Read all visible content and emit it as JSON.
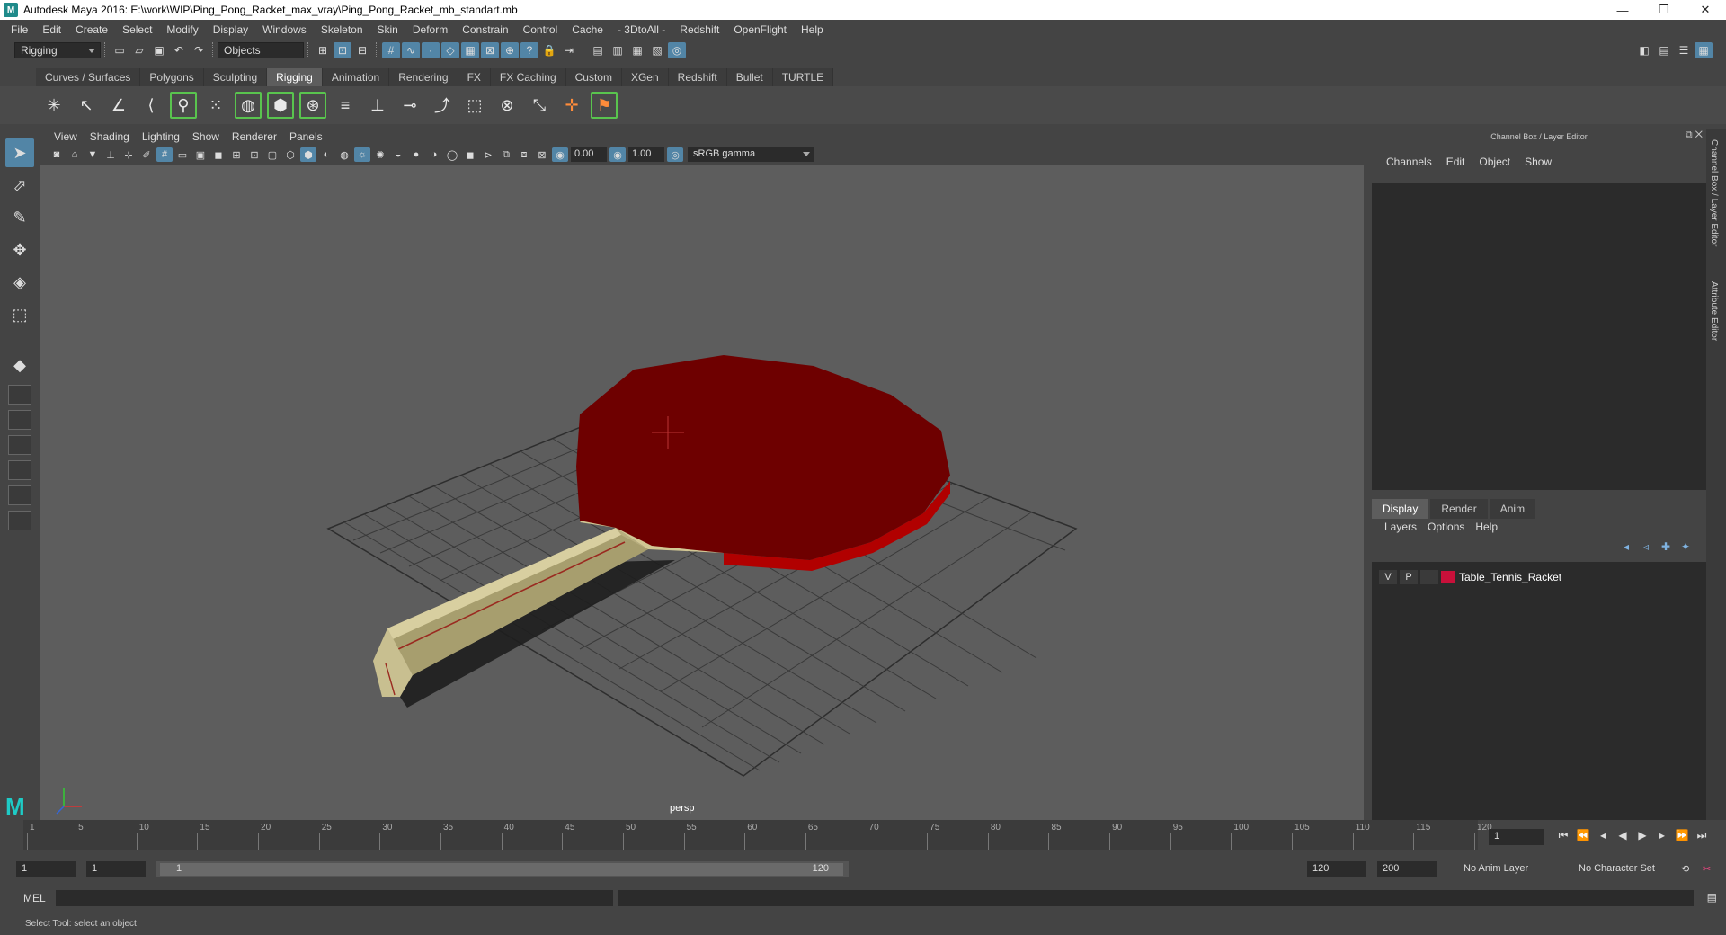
{
  "window": {
    "title": "Autodesk Maya 2016: E:\\work\\WIP\\Ping_Pong_Racket_max_vray\\Ping_Pong_Racket_mb_standart.mb",
    "minimize": "—",
    "maximize": "❐",
    "close": "✕"
  },
  "menubar": [
    "File",
    "Edit",
    "Create",
    "Select",
    "Modify",
    "Display",
    "Windows",
    "Skeleton",
    "Skin",
    "Deform",
    "Constrain",
    "Control",
    "Cache",
    "- 3DtoAll -",
    "Redshift",
    "OpenFlight",
    "Help"
  ],
  "statusline": {
    "mode": "Rigging",
    "selection": "Objects"
  },
  "shelf_tabs": [
    "Curves / Surfaces",
    "Polygons",
    "Sculpting",
    "Rigging",
    "Animation",
    "Rendering",
    "FX",
    "FX Caching",
    "Custom",
    "XGen",
    "Redshift",
    "Bullet",
    "TURTLE"
  ],
  "shelf_active": "Rigging",
  "viewport": {
    "menu": [
      "View",
      "Shading",
      "Lighting",
      "Show",
      "Renderer",
      "Panels"
    ],
    "exposure": "0.00",
    "gamma": "1.00",
    "color_space": "sRGB gamma",
    "camera": "persp"
  },
  "channel_box": {
    "title": "Channel Box / Layer Editor",
    "menu": [
      "Channels",
      "Edit",
      "Object",
      "Show"
    ]
  },
  "layer_editor": {
    "tabs": [
      "Display",
      "Render",
      "Anim"
    ],
    "menu": [
      "Layers",
      "Options",
      "Help"
    ],
    "layers": [
      {
        "v": "V",
        "p": "P",
        "name": "Table_Tennis_Racket",
        "color": "#c8103a"
      }
    ]
  },
  "side_tabs": [
    "Channel Box / Layer Editor",
    "Attribute Editor"
  ],
  "timeslider": {
    "ticks": [
      "1",
      "5",
      "10",
      "15",
      "20",
      "25",
      "30",
      "35",
      "40",
      "45",
      "50",
      "55",
      "60",
      "65",
      "70",
      "75",
      "80",
      "85",
      "90",
      "95",
      "100",
      "105",
      "110",
      "115",
      "120"
    ],
    "current_frame": "1"
  },
  "range": {
    "start": "1",
    "anim_start": "1",
    "range_start": "1",
    "range_end": "120",
    "anim_end": "120",
    "end": "200",
    "anim_layer": "No Anim Layer",
    "character_set": "No Character Set"
  },
  "cmdline": {
    "label": "MEL"
  },
  "help_line": "Select Tool: select an object"
}
